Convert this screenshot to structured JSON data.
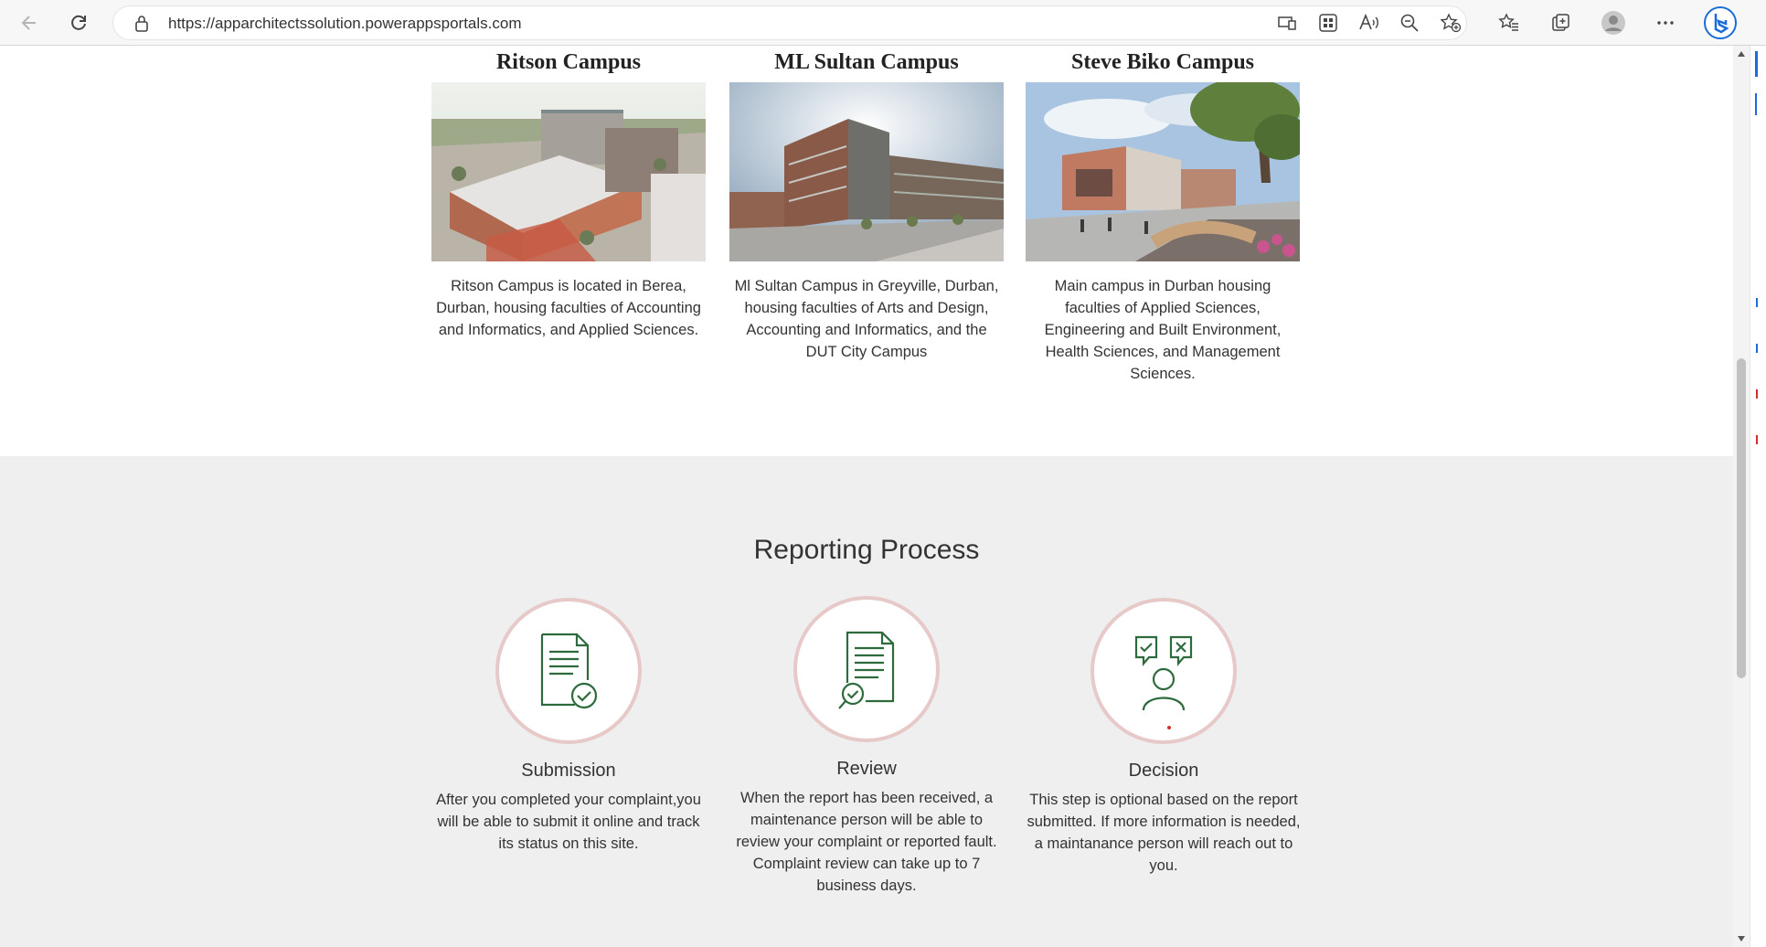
{
  "browser": {
    "url": "https://apparchitectssolution.powerappsportals.com"
  },
  "campuses": [
    {
      "name": "Ritson Campus",
      "description": "Ritson Campus is located in Berea, Durban, housing faculties of Accounting and Informatics, and Applied Sciences."
    },
    {
      "name": "ML Sultan Campus",
      "description": "Ml Sultan Campus in Greyville, Durban, housing faculties of Arts and Design, Accounting and Informatics, and the DUT City Campus"
    },
    {
      "name": "Steve Biko Campus",
      "description": "Main campus in Durban housing faculties of Applied Sciences, Engineering and Built Environment, Health Sciences, and Management Sciences."
    }
  ],
  "reporting": {
    "title": "Reporting Process",
    "steps": [
      {
        "title": "Submission",
        "description": "After you completed your complaint,you will be able to submit it online and track its status on this site.",
        "icon": "document-check-icon"
      },
      {
        "title": "Review",
        "description": "When the report has been received, a maintenance person will be able to review your complaint or reported fault. Complaint review can take up to 7 business days.",
        "icon": "document-search-icon"
      },
      {
        "title": "Decision",
        "description": "This step is optional based on the report submitted. If more information is needed, a maintanance person will reach out to you.",
        "icon": "person-decision-icon"
      }
    ]
  },
  "colors": {
    "icon_green": "#2e6b3c",
    "circle_border": "#e8c9c9",
    "section_bg": "#efefef"
  }
}
